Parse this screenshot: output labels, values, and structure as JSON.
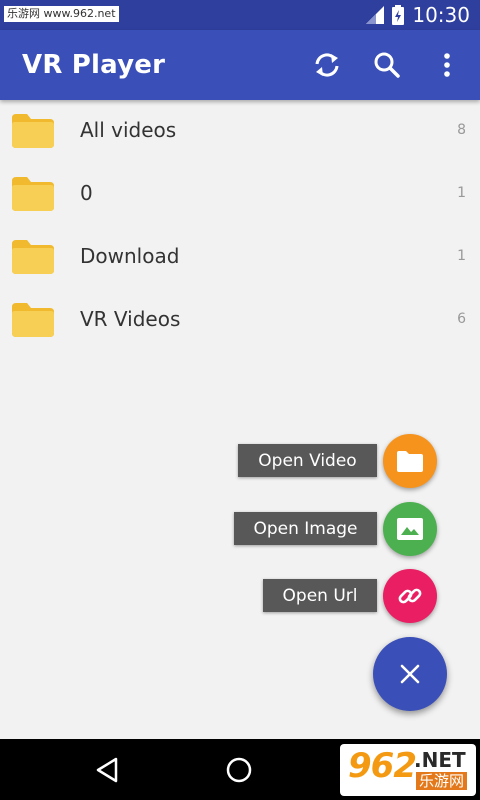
{
  "status_bar": {
    "watermark": "乐游网 www.962.net",
    "time": "10:30",
    "icons": [
      "signal-icon",
      "battery-icon"
    ]
  },
  "app_bar": {
    "title": "VR Player",
    "actions": [
      "sync-icon",
      "search-icon",
      "more-vert-icon"
    ]
  },
  "folders": [
    {
      "name": "All videos",
      "count": "8"
    },
    {
      "name": "0",
      "count": "1"
    },
    {
      "name": "Download",
      "count": "1"
    },
    {
      "name": "VR Videos",
      "count": "6"
    }
  ],
  "fab_menu": {
    "open_video": "Open Video",
    "open_image": "Open Image",
    "open_url": "Open Url"
  },
  "colors": {
    "primary": "#3a4fb7",
    "folder": "#f7c843",
    "video_fab": "#f6931d",
    "image_fab": "#4cb050",
    "url_fab": "#e91e63"
  },
  "corner_logo": {
    "number": "962",
    "net": ".NET",
    "cn": "乐游网"
  }
}
